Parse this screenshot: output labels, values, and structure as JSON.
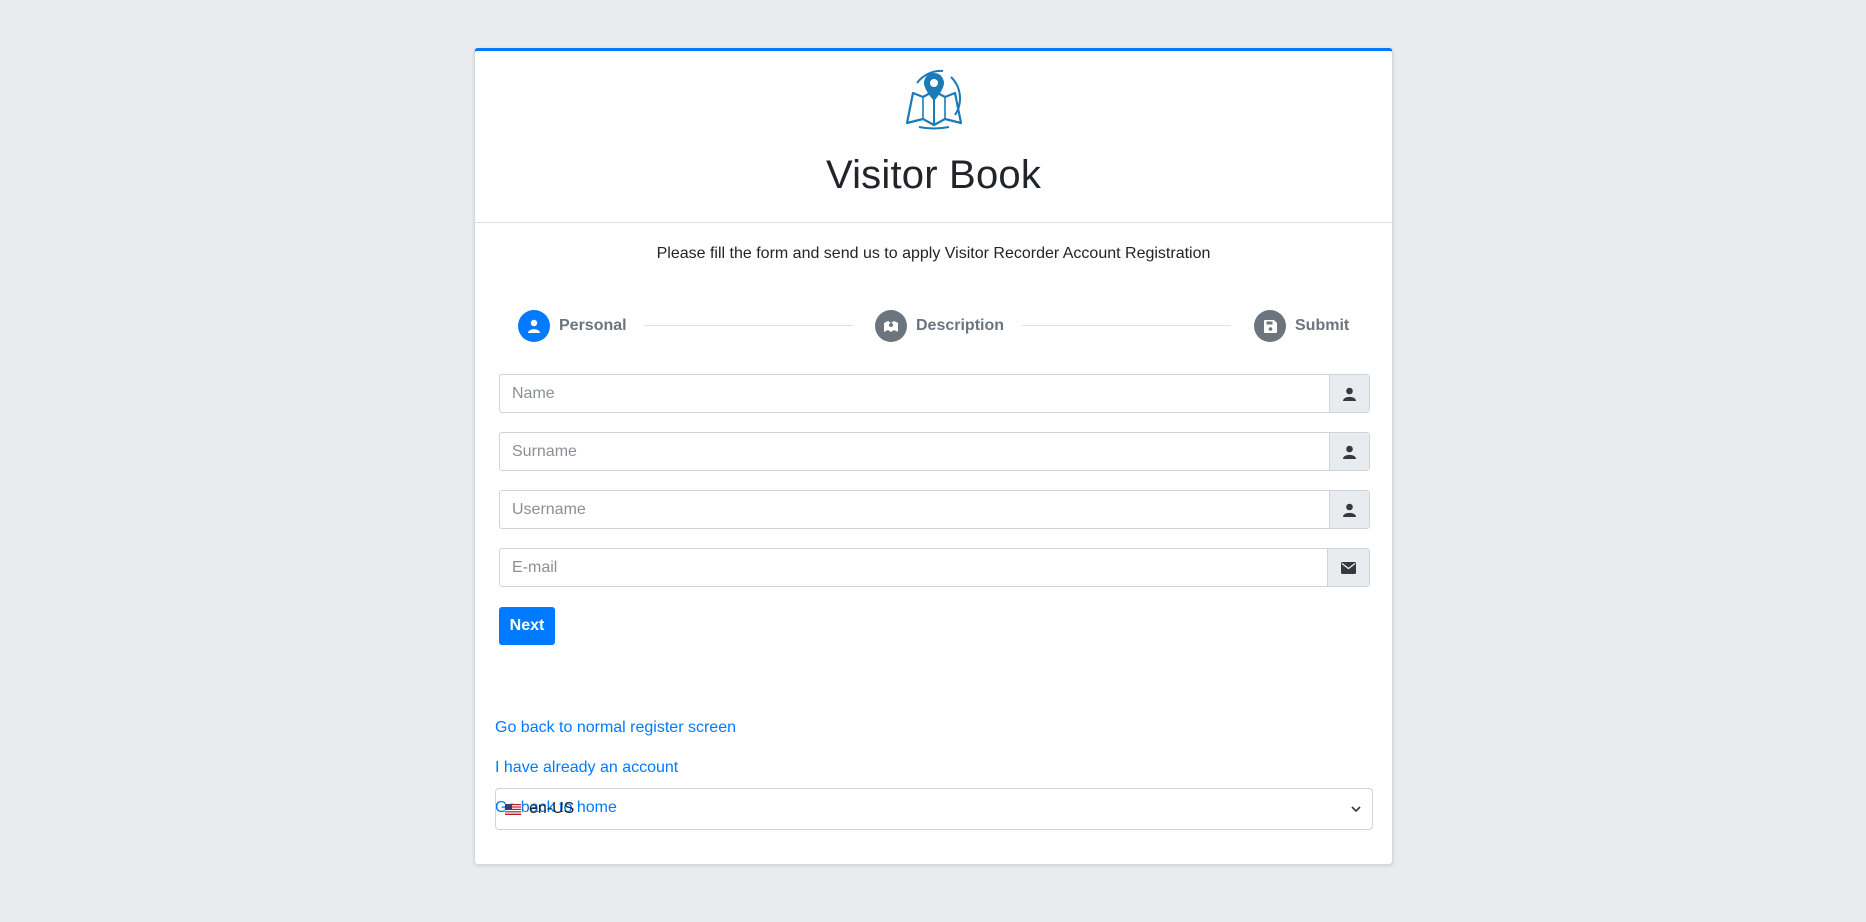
{
  "header": {
    "logo_icon": "map-pin-book-icon",
    "title": "Visitor Book"
  },
  "subtitle": "Please fill the form and send us to apply Visitor Recorder Account Registration",
  "stepper": {
    "active_color": "#007bff",
    "inactive_color": "#6c757d",
    "steps": [
      {
        "label": "Personal",
        "icon": "user-icon",
        "active": true
      },
      {
        "label": "Description",
        "icon": "map-icon",
        "active": false
      },
      {
        "label": "Submit",
        "icon": "floppy-disk-icon",
        "active": false
      }
    ]
  },
  "form": {
    "name": {
      "placeholder": "Name",
      "value": "",
      "icon": "user-icon"
    },
    "surname": {
      "placeholder": "Surname",
      "value": "",
      "icon": "user-icon"
    },
    "username": {
      "placeholder": "Username",
      "value": "",
      "icon": "user-icon"
    },
    "email": {
      "placeholder": "E-mail",
      "value": "",
      "icon": "envelope-icon"
    },
    "next_label": "Next"
  },
  "links": {
    "register": "Go back to normal register screen",
    "login": "I have already an account",
    "home": "Go back to home"
  },
  "language": {
    "selected": "en-US",
    "flag_icon": "us-flag-icon"
  },
  "colors": {
    "primary": "#007bff",
    "background": "#e9ecef"
  }
}
